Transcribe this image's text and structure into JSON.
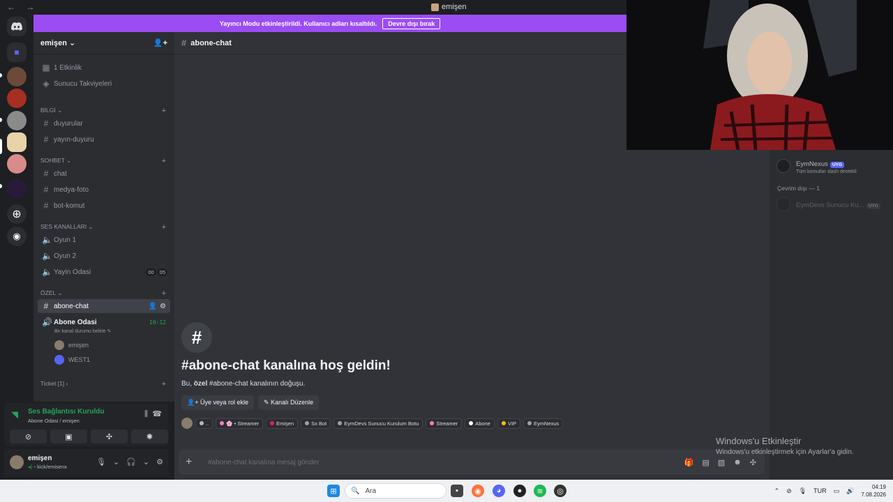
{
  "window": {
    "title": "emişen",
    "nav": "← →"
  },
  "banner": {
    "message": "Yayıncı Modu etkinleştirildi. Kullanıcı adları kısaltıldı.",
    "button": "Devre dışı bırak"
  },
  "server": {
    "name": "emişen",
    "top_items": [
      {
        "icon": "calendar-icon",
        "label": "1 Etkinlik"
      },
      {
        "icon": "boost-icon",
        "label": "Sunucu Takviyeleri"
      }
    ],
    "categories": [
      {
        "name": "BİLGİ",
        "channels": [
          {
            "type": "text",
            "label": "duyurular"
          },
          {
            "type": "text",
            "label": "yayın-duyuru"
          }
        ]
      },
      {
        "name": "SOHBET",
        "channels": [
          {
            "type": "text",
            "label": "chat"
          },
          {
            "type": "text",
            "label": "medya-foto"
          },
          {
            "type": "text",
            "label": "bot-komut"
          }
        ]
      },
      {
        "name": "SES KANALLARI",
        "channels": [
          {
            "type": "voice",
            "label": "Oyun 1"
          },
          {
            "type": "voice",
            "label": "Oyun 2"
          },
          {
            "type": "voice",
            "label": "Yayin Odasi",
            "counts": [
              "00",
              "05"
            ]
          }
        ]
      },
      {
        "name": "ÖZEL",
        "channels": [
          {
            "type": "text",
            "label": "abone-chat",
            "active": true
          },
          {
            "type": "voice",
            "label": "Abone Odasi",
            "timer": "10:12",
            "status": "Bir kanal durumu belirle"
          }
        ]
      }
    ],
    "voice_users": [
      "emişen",
      "WEST1"
    ],
    "ticket_category": "Ticket [1]"
  },
  "voice_panel": {
    "title": "Ses Bağlantısı Kuruldu",
    "subtitle": "Abone Odasi / emişen"
  },
  "user_panel": {
    "name": "emişen",
    "status": "kick/emisenx"
  },
  "channel": {
    "name": "abone-chat",
    "welcome_title": "#abone-chat kanalına hoş geldin!",
    "welcome_sub_prefix": "Bu, ",
    "welcome_sub_bold": "özel",
    "welcome_sub_suffix": " #abone-chat kanalının doğuşu.",
    "btn_add": "Üye veya rol ekle",
    "btn_edit": "Kanalı Düzenle",
    "roles": [
      {
        "label": "..",
        "color": "#b5bac1"
      },
      {
        "label": "🌸 • Streamer",
        "color": "#f47fbd"
      },
      {
        "label": "Emişen",
        "color": "#e91e63"
      },
      {
        "label": "Sx Bot",
        "color": "#95a5a6"
      },
      {
        "label": "EymDevs Sunucu Kurulum Botu",
        "color": "#95a5a6"
      },
      {
        "label": "Streamer",
        "color": "#f47fbd"
      },
      {
        "label": "Abone",
        "color": "#ffffff"
      },
      {
        "label": "VIP",
        "color": "#f1c40f"
      },
      {
        "label": "EymNexus",
        "color": "#95a5a6"
      }
    ],
    "placeholder": "#abone-chat kanalına mesaj gönder"
  },
  "members": {
    "online": {
      "name": "EymNexus",
      "tag": "UYG",
      "status": "Tüm komutlar slash destekli"
    },
    "offline_header": "Çevrim dışı — 1",
    "offline": {
      "name": "EymDevs Sunucu Ku...",
      "tag": "UYG"
    }
  },
  "windows_activation": {
    "title": "Windows'u Etkinleştir",
    "subtitle": "Windows'u etkinleştirmek için Ayarlar'a gidin."
  },
  "taskbar": {
    "search_placeholder": "Ara",
    "lang": "TUR",
    "time": "04:19",
    "date": "7.08.2026"
  }
}
